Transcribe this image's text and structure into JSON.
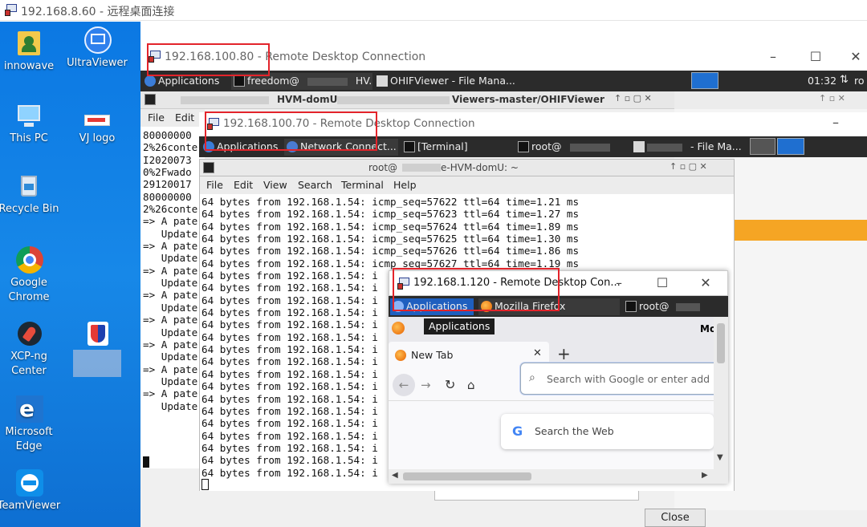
{
  "outer": {
    "title": "192.168.8.60 - 远程桌面连接"
  },
  "desktop_icons": [
    {
      "label": "innowave"
    },
    {
      "label": "UltraViewer"
    },
    {
      "label": "This PC"
    },
    {
      "label": "VJ logo"
    },
    {
      "label": "Recycle Bin"
    },
    {
      "label": "Google Chrome"
    },
    {
      "label": "XCP-ng Center"
    },
    {
      "label": "Microsoft Edge"
    },
    {
      "label": "TeamViewer"
    }
  ],
  "w80": {
    "title": "192.168.100.80 - Remote Desktop Connection",
    "panel": {
      "applications": "Applications",
      "terminal_task": "freedom@",
      "terminal_task_suffix": "HV...",
      "file_manager": "OHIFViewer - File Mana...",
      "clock": "01:32",
      "user": "ro"
    },
    "terminal_title": "HVM-domU:",
    "terminal_title_path": "Viewers-master/OHIFViewer",
    "menu": {
      "file": "File",
      "edit": "Edit"
    },
    "lines": [
      "80000000",
      "2%26conte",
      "I2020073",
      "0%2Fwado",
      "29120017",
      "80000000",
      "2%26conte",
      "=> A pate",
      "   Update",
      "=> A pate",
      "   Update",
      "=> A pate",
      "   Update",
      "=> A pate",
      "   Update",
      "=> A pate",
      "   Update",
      "=> A pate",
      "   Update",
      "=> A pate",
      "   Update",
      "=> A pate",
      "   Update"
    ],
    "close_label": "Close"
  },
  "w70": {
    "title": "192.168.100.70 - Remote Desktop Connection",
    "panel": {
      "applications": "Applications",
      "network": "Network Connect...",
      "terminal": "[Terminal]",
      "root": "root@",
      "file_manager": "- File Ma..."
    },
    "terminal_title": "root@",
    "terminal_title_suffix": "e-HVM-domU: ~",
    "menu": {
      "file": "File",
      "edit": "Edit",
      "view": "View",
      "search": "Search",
      "terminal": "Terminal",
      "help": "Help"
    },
    "lines": [
      "64 bytes from 192.168.1.54: icmp_seq=57622 ttl=64 time=1.21 ms",
      "64 bytes from 192.168.1.54: icmp_seq=57623 ttl=64 time=1.27 ms",
      "64 bytes from 192.168.1.54: icmp_seq=57624 ttl=64 time=1.89 ms",
      "64 bytes from 192.168.1.54: icmp_seq=57625 ttl=64 time=1.30 ms",
      "64 bytes from 192.168.1.54: icmp_seq=57626 ttl=64 time=1.86 ms",
      "64 bytes from 192.168.1.54: icmp_seq=57627 ttl=64 time=1.19 ms",
      "64 bytes from 192.168.1.54: i",
      "64 bytes from 192.168.1.54: i",
      "64 bytes from 192.168.1.54: i",
      "64 bytes from 192.168.1.54: i",
      "64 bytes from 192.168.1.54: i",
      "64 bytes from 192.168.1.54: i",
      "64 bytes from 192.168.1.54: i",
      "64 bytes from 192.168.1.54: i",
      "64 bytes from 192.168.1.54: i",
      "64 bytes from 192.168.1.54: i",
      "64 bytes from 192.168.1.54: i",
      "64 bytes from 192.168.1.54: i",
      "64 bytes from 192.168.1.54: i",
      "64 bytes from 192.168.1.54: i",
      "64 bytes from 192.168.1.54: i",
      "64 bytes from 192.168.1.54: i",
      "64 bytes from 192.168.1.54: i"
    ]
  },
  "w120": {
    "title": "192.168.1.120 - Remote Desktop Con...",
    "panel": {
      "applications": "Applications",
      "firefox": "Mozilla Firefox",
      "root": "root@"
    },
    "tooltip": "Applications",
    "menu_partial": "Mo",
    "tab_label": "New Tab",
    "urlbar_placeholder": "Search with Google or enter add",
    "search_web": "Search the Web"
  },
  "colors": {
    "desktop_blue": "#0b78e3",
    "panel_dark": "#2b2b2b",
    "highlight_red": "#e3242b",
    "orange": "#f5a524"
  }
}
